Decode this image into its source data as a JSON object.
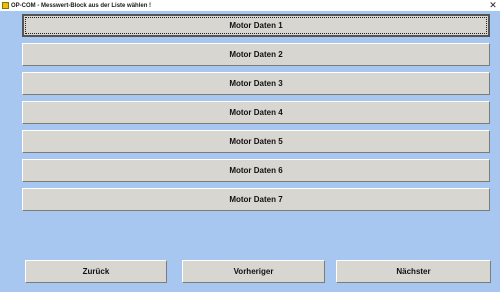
{
  "window": {
    "title": "OP-COM - Messwert-Block aus der Liste wählen !",
    "close_glyph": "✕"
  },
  "blocks": [
    {
      "label": "Motor Daten 1"
    },
    {
      "label": "Motor Daten 2"
    },
    {
      "label": "Motor Daten 3"
    },
    {
      "label": "Motor Daten 4"
    },
    {
      "label": "Motor Daten 5"
    },
    {
      "label": "Motor Daten 6"
    },
    {
      "label": "Motor Daten 7"
    }
  ],
  "nav": {
    "back_label": "Zurück",
    "prev_label": "Vorheriger",
    "next_label": "Nächster"
  },
  "icons": {
    "app": "app-icon",
    "close": "close-icon"
  },
  "colors": {
    "background": "#a8c7f0",
    "button_face": "#d8d6d1",
    "app_icon": "#e8c200"
  }
}
